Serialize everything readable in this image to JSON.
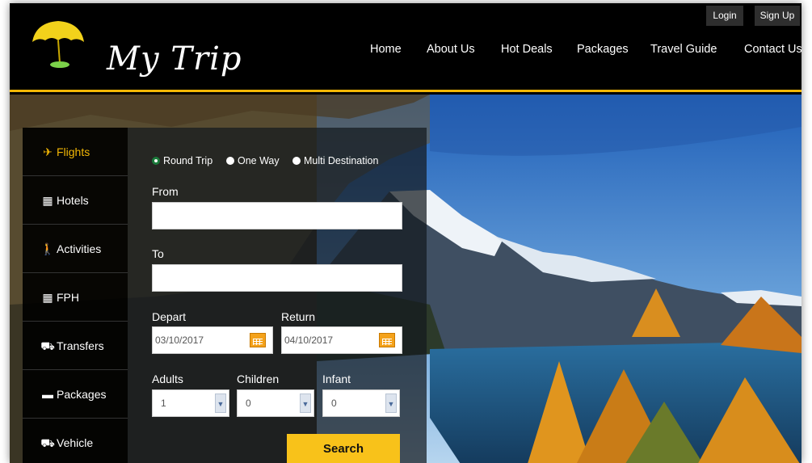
{
  "brand": {
    "name": "My Trip"
  },
  "auth": {
    "login": "Login",
    "signup": "Sign Up"
  },
  "nav": [
    "Home",
    "About Us",
    "Hot Deals",
    "Packages",
    "Travel Guide",
    "Contact Us"
  ],
  "side_tabs": [
    {
      "label": "Flights",
      "icon": "plane-icon",
      "active": true
    },
    {
      "label": "Hotels",
      "icon": "building-icon",
      "active": false
    },
    {
      "label": "Activities",
      "icon": "walker-icon",
      "active": false
    },
    {
      "label": "FPH",
      "icon": "building-icon",
      "active": false
    },
    {
      "label": "Transfers",
      "icon": "car-icon",
      "active": false
    },
    {
      "label": "Packages",
      "icon": "ticket-icon",
      "active": false
    },
    {
      "label": "Vehicle",
      "icon": "car-icon",
      "active": false
    }
  ],
  "search": {
    "trip_types": [
      "Round Trip",
      "One Way",
      "Multi Destination"
    ],
    "selected_trip_type": "Round Trip",
    "from_label": "From",
    "from_value": "",
    "to_label": "To",
    "to_value": "",
    "depart_label": "Depart",
    "depart_value": "03/10/2017",
    "return_label": "Return",
    "return_value": "04/10/2017",
    "adults_label": "Adults",
    "adults_value": "1",
    "children_label": "Children",
    "children_value": "0",
    "infant_label": "Infant",
    "infant_value": "0",
    "button": "Search"
  },
  "colors": {
    "accent": "#f2b705",
    "button": "#f8c21a",
    "header_bg": "#000000",
    "calendar": "#f4a21b"
  }
}
